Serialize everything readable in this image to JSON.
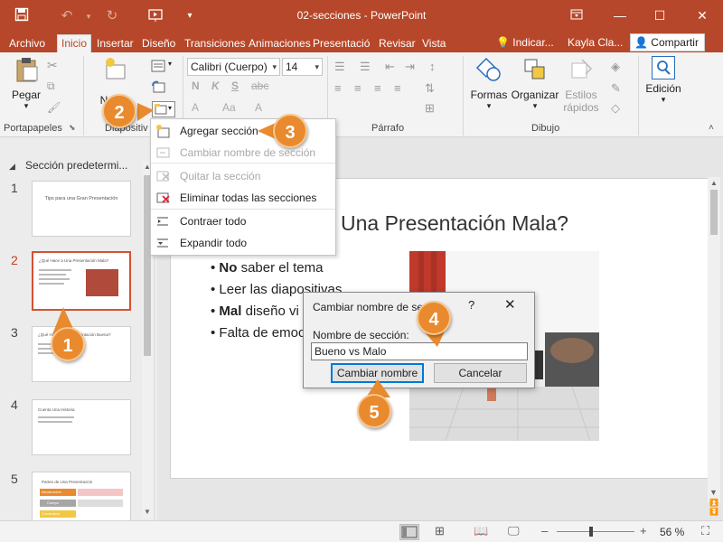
{
  "window": {
    "title": "02-secciones  -  PowerPoint",
    "min_icon": "minimize-icon",
    "max_icon": "maximize-icon",
    "close_icon": "close-icon"
  },
  "tabs": [
    {
      "label": "Archivo"
    },
    {
      "label": "Inicio"
    },
    {
      "label": "Insertar"
    },
    {
      "label": "Diseño"
    },
    {
      "label": "Transiciones"
    },
    {
      "label": "Animaciones"
    },
    {
      "label": "Presentació"
    },
    {
      "label": "Revisar"
    },
    {
      "label": "Vista"
    }
  ],
  "tellme": "Indicar...",
  "user": "Kayla Cla...",
  "share": "Compartir",
  "ribbon": {
    "paste": "Pegar",
    "new_slide": "Nueva",
    "new_slide_2": "dia",
    "font_name": "Calibri (Cuerpo)",
    "font_size": "14",
    "shapes": "Formas",
    "arrange": "Organizar",
    "styles_1": "Estilos",
    "styles_2": "rápidos",
    "editing": "Edición",
    "groups": {
      "clipboard": "Portapapeles",
      "slides": "Diapositiv",
      "paragraph": "Párrafo",
      "drawing": "Dibujo"
    },
    "bold": "N",
    "italic": "K",
    "underline": "S",
    "strike": "abc"
  },
  "section_menu": {
    "items": [
      {
        "label": "Agregar sección",
        "enabled": true
      },
      {
        "label": "Cambiar nombre de sección",
        "enabled": false
      },
      {
        "label": "Quitar la sección",
        "enabled": false
      },
      {
        "label": "Eliminar todas las secciones",
        "enabled": true
      },
      {
        "label": "Contraer todo",
        "enabled": true
      },
      {
        "label": "Expandir todo",
        "enabled": true
      }
    ]
  },
  "sidebar": {
    "section_name": "Sección predetermi...",
    "slides": [
      {
        "num": "1",
        "title": "Tips para una Gran Presentación"
      },
      {
        "num": "2",
        "title": "¿Qué Hace a Una Presentación Mala?"
      },
      {
        "num": "3",
        "title": "¿Qué Hace a Una Presentación Buena?"
      },
      {
        "num": "4",
        "title": "Cuenta Una Historia"
      },
      {
        "num": "5",
        "title": "Partes de Una Presentación"
      }
    ],
    "thumb5_labels": [
      "Introducción",
      "Cuerpo",
      "Conclusión"
    ]
  },
  "slide": {
    "title": "Una Presentación Mala?",
    "bullets": [
      {
        "bold": "No",
        "rest": " saber el tema"
      },
      {
        "bold": "",
        "rest": "Leer las diapositivas"
      },
      {
        "bold": "Mal",
        "rest": " diseño vi"
      },
      {
        "bold": "",
        "rest": "Falta de emoc"
      }
    ]
  },
  "dialog": {
    "title": "Cambiar nombre de se",
    "help": "?",
    "close": "✕",
    "label": "Nombre de sección:",
    "value": "Bueno vs Malo",
    "ok": "Cambiar nombre",
    "cancel": "Cancelar"
  },
  "callouts": [
    "1",
    "2",
    "3",
    "4",
    "5"
  ],
  "status": {
    "zoom": "56 %"
  },
  "colors": {
    "accent": "#b7472a",
    "callout": "#e98a2e"
  }
}
